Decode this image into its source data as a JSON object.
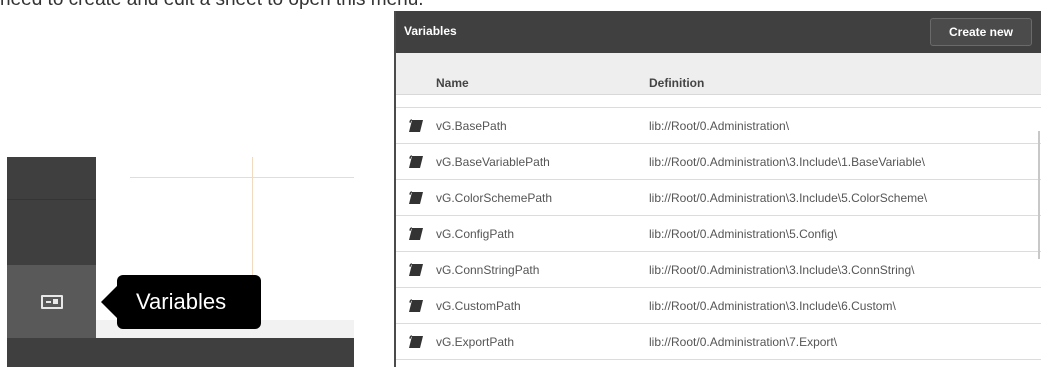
{
  "intro_text": "need to create and edit a sheet to open this menu.",
  "sidebar": {
    "variables_icon": "variables-icon",
    "tooltip": "Variables"
  },
  "dialog": {
    "title": "Variables",
    "create_button": "Create new",
    "columns": {
      "name": "Name",
      "definition": "Definition"
    },
    "row_icon": "script-icon",
    "rows": [
      {
        "name": "vG.BasePath",
        "definition": "lib://Root/0.Administration\\"
      },
      {
        "name": "vG.BaseVariablePath",
        "definition": "lib://Root/0.Administration\\3.Include\\1.BaseVariable\\"
      },
      {
        "name": "vG.ColorSchemePath",
        "definition": "lib://Root/0.Administration\\3.Include\\5.ColorScheme\\"
      },
      {
        "name": "vG.ConfigPath",
        "definition": "lib://Root/0.Administration\\5.Config\\"
      },
      {
        "name": "vG.ConnStringPath",
        "definition": "lib://Root/0.Administration\\3.Include\\3.ConnString\\"
      },
      {
        "name": "vG.CustomPath",
        "definition": "lib://Root/0.Administration\\3.Include\\6.Custom\\"
      },
      {
        "name": "vG.ExportPath",
        "definition": "lib://Root/0.Administration\\7.Export\\"
      }
    ]
  }
}
